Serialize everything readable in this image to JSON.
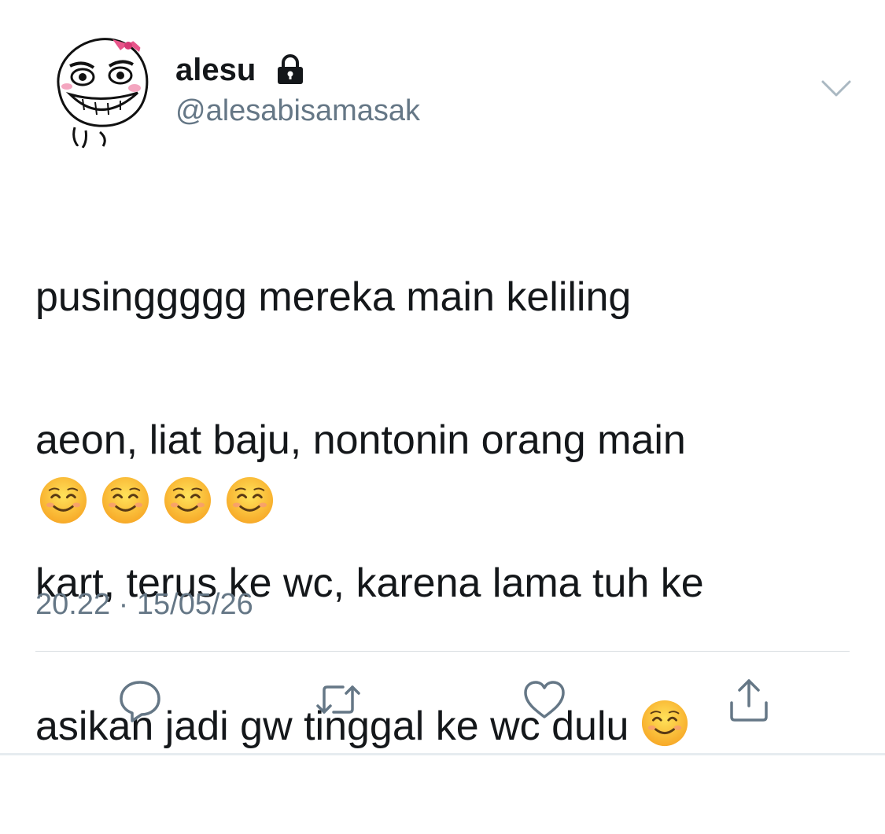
{
  "tweet": {
    "author": {
      "display_name": "alesu",
      "handle": "@alesabisamasak",
      "avatar_icon": "troll-face-avatar",
      "protected_icon": "lock-icon"
    },
    "menu_icon": "chevron-down-icon",
    "text_lines": [
      "pusinggggg mereka main keliling",
      "aeon, liat baju, nontonin orang main",
      "kart, terus ke wc, karena lama tuh ke",
      "asikan jadi gw tinggal ke wc dulu"
    ],
    "emoji_name": "smiling-face-emoji",
    "emoji_char": "☺️",
    "timestamp": "20.22 · 15/05/26",
    "actions": [
      {
        "name": "reply-icon"
      },
      {
        "name": "retweet-icon"
      },
      {
        "name": "like-icon"
      },
      {
        "name": "share-icon"
      }
    ]
  },
  "colors": {
    "text_primary": "#14171a",
    "text_secondary": "#657786",
    "divider": "#d8dde1",
    "icon": "#657786"
  }
}
